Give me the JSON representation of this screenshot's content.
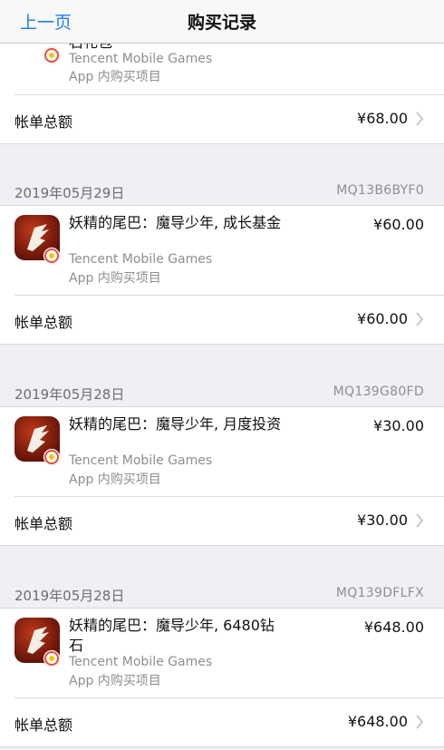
{
  "nav": {
    "back_label": "上一页",
    "title": "购买记录"
  },
  "top_partial": {
    "title_fragment": "石礼包",
    "developer": "Tencent Mobile Games",
    "type": "App 内购买项目",
    "total_label": "帐单总额",
    "total_value": "¥68.00"
  },
  "orders": [
    {
      "date": "2019年05月29日",
      "order_id": "MQ13B6BYF0",
      "title": "妖精的尾巴：魔导少年, 成长基金",
      "developer": "Tencent Mobile Games",
      "type": "App 内购买项目",
      "price": "¥60.00",
      "total_label": "帐单总额",
      "total_value": "¥60.00"
    },
    {
      "date": "2019年05月28日",
      "order_id": "MQ139G80FD",
      "title": "妖精的尾巴：魔导少年, 月度投资",
      "developer": "Tencent Mobile Games",
      "type": "App 内购买项目",
      "price": "¥30.00",
      "total_label": "帐单总额",
      "total_value": "¥30.00"
    },
    {
      "date": "2019年05月28日",
      "order_id": "MQ139DFLFX",
      "title": "妖精的尾巴：魔导少年, 6480钻石",
      "developer": "Tencent Mobile Games",
      "type": "App 内购买项目",
      "price": "¥648.00",
      "total_label": "帐单总额",
      "total_value": "¥648.00"
    }
  ],
  "colors": {
    "accent": "#1a7ef5",
    "background": "#efeff4"
  }
}
